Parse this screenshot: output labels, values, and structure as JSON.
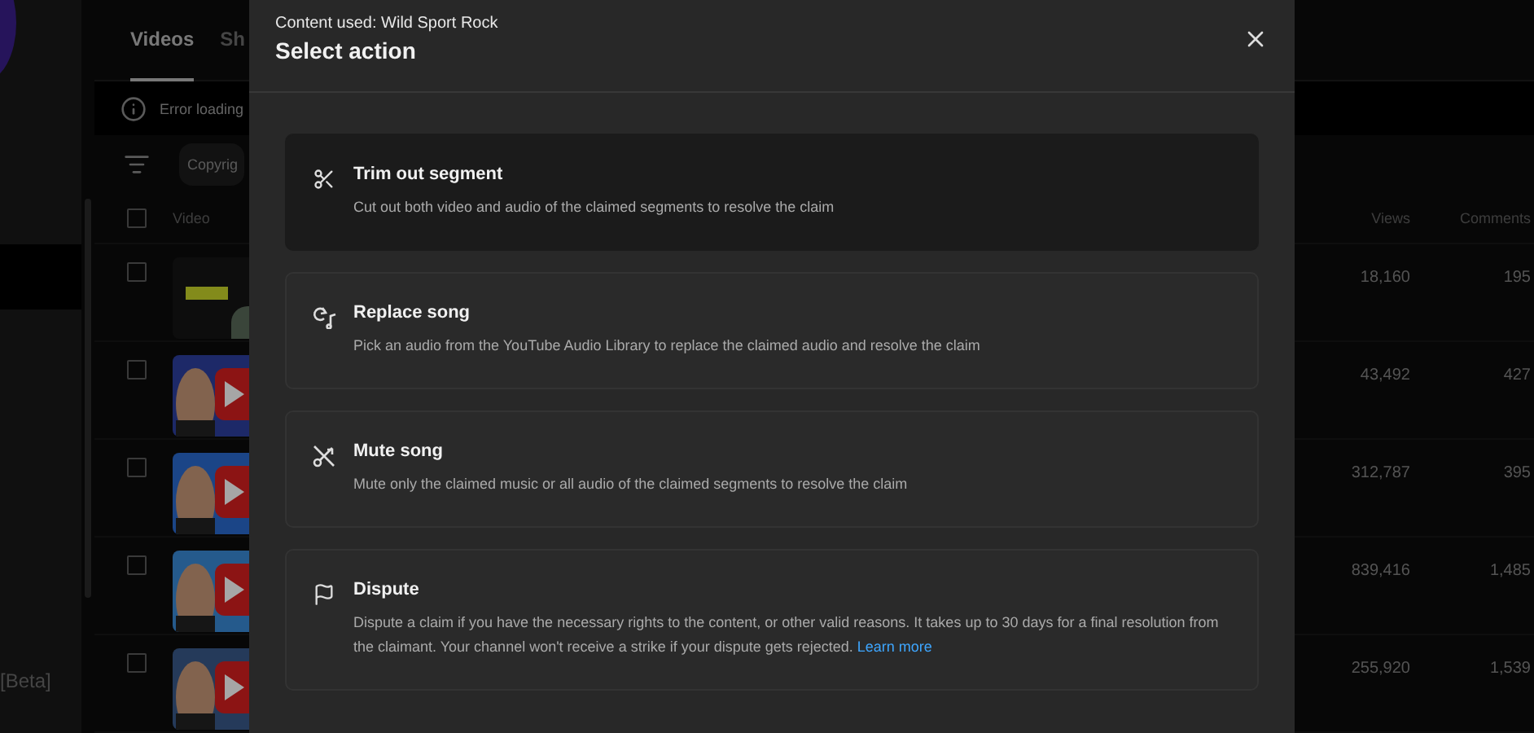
{
  "sidebar": {
    "badge": "[Beta]"
  },
  "tabs": [
    {
      "label": "Videos",
      "selected": true
    },
    {
      "label": "Sh",
      "selected": false
    }
  ],
  "error_banner": {
    "text": "Error loading"
  },
  "filter": {
    "chip": "Copyrig"
  },
  "table": {
    "header_checked": false,
    "columns": [
      "Video",
      "Views",
      "Comments"
    ],
    "rows": [
      {
        "checked": false,
        "views": "18,160",
        "comments": "195"
      },
      {
        "checked": false,
        "views": "43,492",
        "comments": "427"
      },
      {
        "checked": false,
        "views": "312,787",
        "comments": "395"
      },
      {
        "checked": false,
        "views": "839,416",
        "comments": "1,485"
      },
      {
        "checked": false,
        "views": "255,920",
        "comments": "1,539"
      }
    ]
  },
  "dialog": {
    "subtitle": "Content used: Wild Sport Rock",
    "title": "Select action",
    "actions": [
      {
        "kind": "trim",
        "title": "Trim out segment",
        "description": "Cut out both video and audio of the claimed segments to resolve the claim",
        "selected": true
      },
      {
        "kind": "replace",
        "title": "Replace song",
        "description": "Pick an audio from the YouTube Audio Library to replace the claimed audio and resolve the claim",
        "selected": false
      },
      {
        "kind": "mute",
        "title": "Mute song",
        "description": "Mute only the claimed music or all audio of the claimed segments to resolve the claim",
        "selected": false
      },
      {
        "kind": "dispute",
        "title": "Dispute",
        "description": "Dispute a claim if you have the necessary rights to the content, or other valid reasons. It takes up to 30 days for a final resolution from the claimant. Your channel won't receive a strike if your dispute gets rejected.",
        "link": "Learn more",
        "selected": false
      }
    ]
  }
}
